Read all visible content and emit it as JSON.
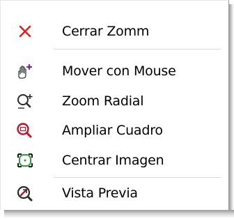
{
  "menu": {
    "items": [
      {
        "label": "Cerrar Zomm",
        "icon": "close-x-icon"
      },
      {
        "label": "Mover con Mouse",
        "icon": "hand-move-icon"
      },
      {
        "label": "Zoom Radial",
        "icon": "zoom-in-icon"
      },
      {
        "label": "Ampliar Cuadro",
        "icon": "zoom-box-icon"
      },
      {
        "label": "Centrar Imagen",
        "icon": "center-image-icon"
      },
      {
        "label": "Vista Previa",
        "icon": "preview-icon"
      }
    ]
  },
  "colors": {
    "close": "#e02020",
    "icon_dark": "#3a3a3a",
    "icon_red": "#c0102a",
    "icon_green": "#2f9a3a",
    "accent_blue": "#3355cc"
  }
}
